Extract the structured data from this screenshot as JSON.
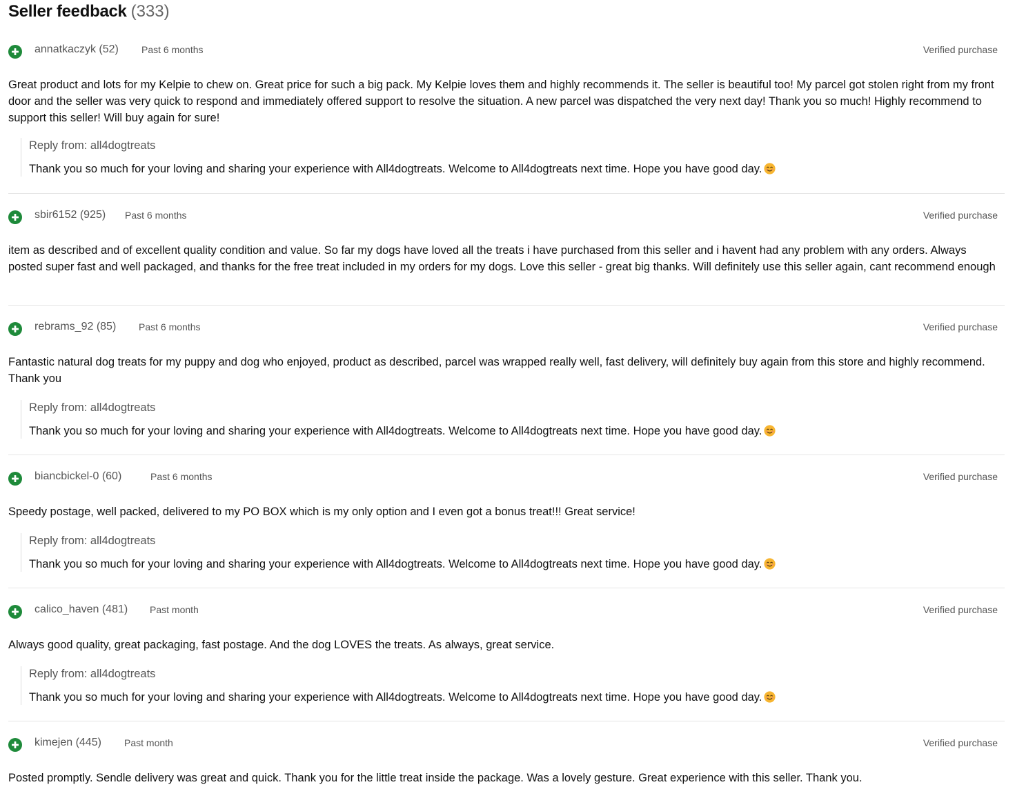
{
  "header": {
    "title": "Seller feedback",
    "count": "(333)"
  },
  "feedback": [
    {
      "user": "annatkaczyk (52)",
      "time": "Past 6 months",
      "verified": "Verified purchase",
      "comment": "Great product and lots for my Kelpie to chew on. Great price for such a big pack. My Kelpie loves them and highly recommends it. The seller is beautiful too! My parcel got stolen right from my front door and the seller was very quick to respond and immediately offered support to resolve the situation. A new parcel was dispatched the very next day! Thank you so much! Highly recommend to support this seller! Will buy again for sure!",
      "reply_label": "Reply from: all4dogtreats",
      "reply_text": "Thank you so much for your loving and sharing your experience with All4dogtreats. Welcome to All4dogtreats next time. Hope you have good day."
    },
    {
      "user": "sbir6152 (925)",
      "time": "Past 6 months",
      "verified": "Verified purchase",
      "comment": "item as described and of excellent quality condition and value. So far my dogs have loved all the treats i have purchased from this seller and i havent had any problem with any orders. Always posted super fast and well packaged, and thanks for the free treat included in my orders for my dogs. Love this seller - great big thanks. Will definitely use this seller again, cant recommend enough"
    },
    {
      "user": "rebrams_92 (85)",
      "time": "Past 6 months",
      "verified": "Verified purchase",
      "comment": "Fantastic natural dog treats for my puppy and dog who enjoyed, product as described, parcel was wrapped really well, fast delivery, will definitely buy again from this store and highly recommend. Thank you",
      "reply_label": "Reply from: all4dogtreats",
      "reply_text": "Thank you so much for your loving and sharing your experience with All4dogtreats. Welcome to All4dogtreats next time. Hope you have good day."
    },
    {
      "user": "biancbickel-0 (60)",
      "time": "Past 6 months",
      "verified": "Verified purchase",
      "comment": "Speedy postage, well packed, delivered to my PO BOX which is my only option and I even got a bonus treat!!! Great service!",
      "reply_label": "Reply from: all4dogtreats",
      "reply_text": "Thank you so much for your loving and sharing your experience with All4dogtreats. Welcome to All4dogtreats next time. Hope you have good day."
    },
    {
      "user": "calico_haven (481)",
      "time": "Past month",
      "verified": "Verified purchase",
      "comment": "Always good quality, great packaging, fast postage. And the dog LOVES the treats. As always, great service.",
      "reply_label": "Reply from: all4dogtreats",
      "reply_text": "Thank you so much for your loving and sharing your experience with All4dogtreats. Welcome to All4dogtreats next time. Hope you have good day."
    },
    {
      "user": "kimejen (445)",
      "time": "Past month",
      "verified": "Verified purchase",
      "comment": "Posted promptly. Sendle delivery was great and quick. Thank you for the little treat inside the package. Was a lovely gesture. Great experience with this seller. Thank you."
    }
  ],
  "icons": {
    "positive": "plus-circle-icon",
    "emoji": "smiling-face-icon"
  },
  "colors": {
    "positive_green": "#1e8a3a",
    "emoji_yellow": "#f7b531"
  }
}
